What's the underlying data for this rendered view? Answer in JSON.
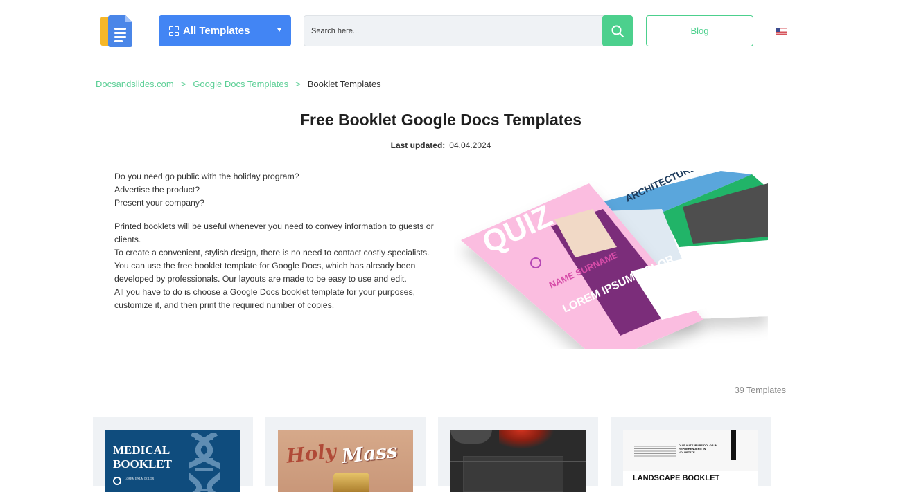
{
  "header": {
    "logo_alt": "Docsandslides logo",
    "all_templates_label": "All Templates",
    "search_placeholder": "Search here...",
    "blog_label": "Blog",
    "language": "English (US)",
    "colors": {
      "primary_blue": "#4285f4",
      "accent_green": "#4cd08d"
    }
  },
  "breadcrumb": {
    "items": [
      {
        "label": "Docsandslides.com"
      },
      {
        "label": "Google Docs Templates"
      }
    ],
    "separator": ">",
    "current": "Booklet Templates"
  },
  "page": {
    "title": "Free Booklet Google Docs Templates",
    "last_updated_label": "Last updated:",
    "last_updated_value": "04.04.2024"
  },
  "intro": {
    "paragraphs": [
      [
        "Do you need go public with the holiday program?",
        "Advertise the product?",
        "Present your company?"
      ],
      [
        "Printed booklets will be useful whenever you need to convey information to guests or clients.",
        "To create a convenient, stylish design, there is no need to contact costly specialists. You can use the free booklet template for Google Docs, which has already been developed by professionals. Our layouts are made to be easy to use and edit.",
        "All you have to do is choose a Google Docs booklet template for your purposes, customize it, and then print the required number of copies."
      ]
    ],
    "hero_texts": {
      "quiz": "QUIZ",
      "name": "NAME SURNAME",
      "lorem": "LOREM IPSUM DOLOR",
      "arch": "ARCHITECTURE"
    }
  },
  "templates": {
    "count_label": "39 Templates",
    "cards": [
      {
        "title_lines": [
          "MEDICAL",
          "BOOKLET"
        ],
        "subtitle": "LOREM IPSUM DOLOR"
      },
      {
        "title_a": "Holy",
        "title_b": "Mass"
      },
      {
        "title": ""
      },
      {
        "title": "LANDSCAPE BOOKLET",
        "heading": "DUIS AUTE IRURE DOLOR IN REPREHENDERIT IN VOLUPTATE"
      }
    ]
  }
}
